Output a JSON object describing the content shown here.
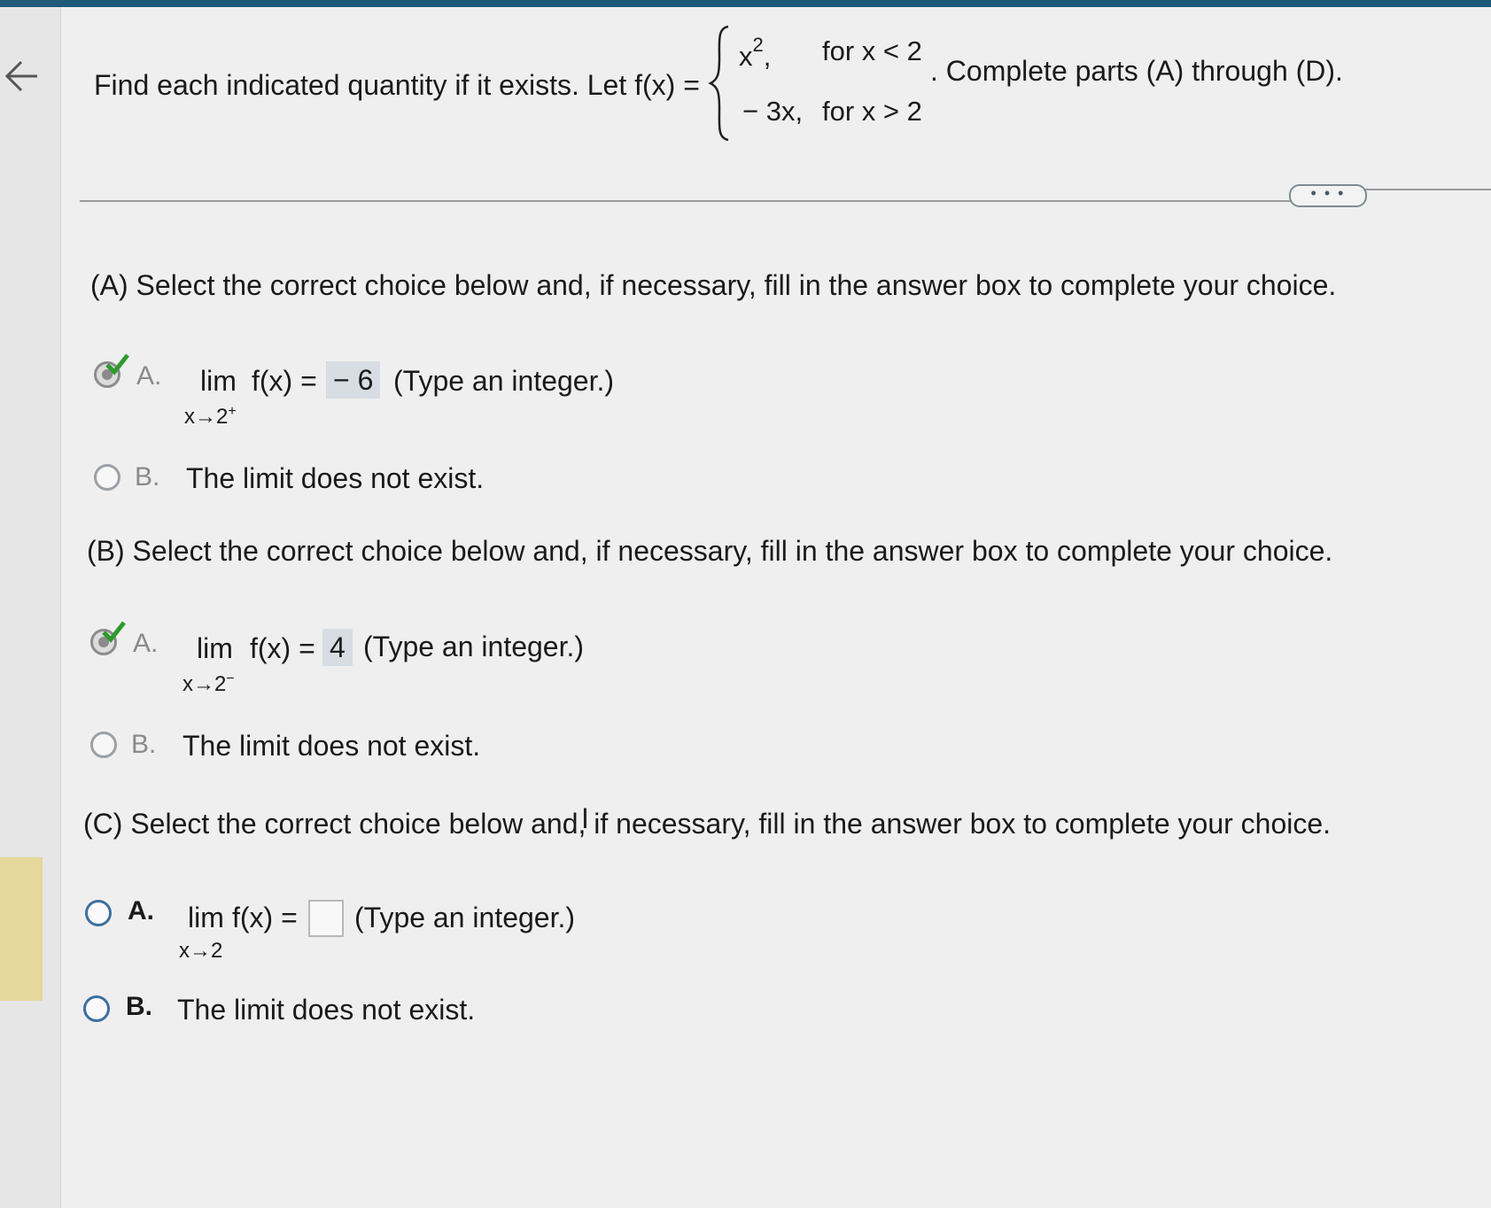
{
  "question": {
    "intro": "Find each indicated quantity if it exists. Let f(x) =",
    "piece1_expr": "x",
    "piece1_exp": "2",
    "piece1_sep": ",",
    "piece1_cond": "for x < 2",
    "piece2_expr": "− 3x,",
    "piece2_cond": "for x > 2",
    "outro": ". Complete parts (A) through (D)."
  },
  "more_button": "• • •",
  "parts": [
    {
      "prompt": "(A) Select the correct choice below and, if necessary, fill in the answer box to complete your choice.",
      "a_letter": "A.",
      "lim": "lim",
      "fx": "f(x) =",
      "sub": "x→2",
      "sub_sup": "+",
      "answer": "− 6",
      "hint": "(Type an integer.)",
      "b_letter": "B.",
      "b_text": "The limit does not exist."
    },
    {
      "prompt": "(B) Select the correct choice below and, if necessary, fill in the answer box to complete your choice.",
      "a_letter": "A.",
      "lim": "lim",
      "fx": "f(x) =",
      "sub": "x→2",
      "sub_sup": "−",
      "answer": "4",
      "hint": "(Type an integer.)",
      "b_letter": "B.",
      "b_text": "The limit does not exist."
    },
    {
      "prompt": "(C) Select the correct choice below and, if necessary, fill in the answer box to complete your choice.",
      "a_letter": "A.",
      "lim": "lim",
      "fx": "f(x) =",
      "sub": "x→2",
      "answer": "",
      "hint": "(Type an integer.)",
      "b_letter": "B.",
      "b_text": "The limit does not exist."
    }
  ],
  "colors": {
    "header": "#1f5a78",
    "check": "#2e9a2e",
    "answer_fill": "#d7dde3",
    "radio_blue": "#3d6f9f"
  }
}
